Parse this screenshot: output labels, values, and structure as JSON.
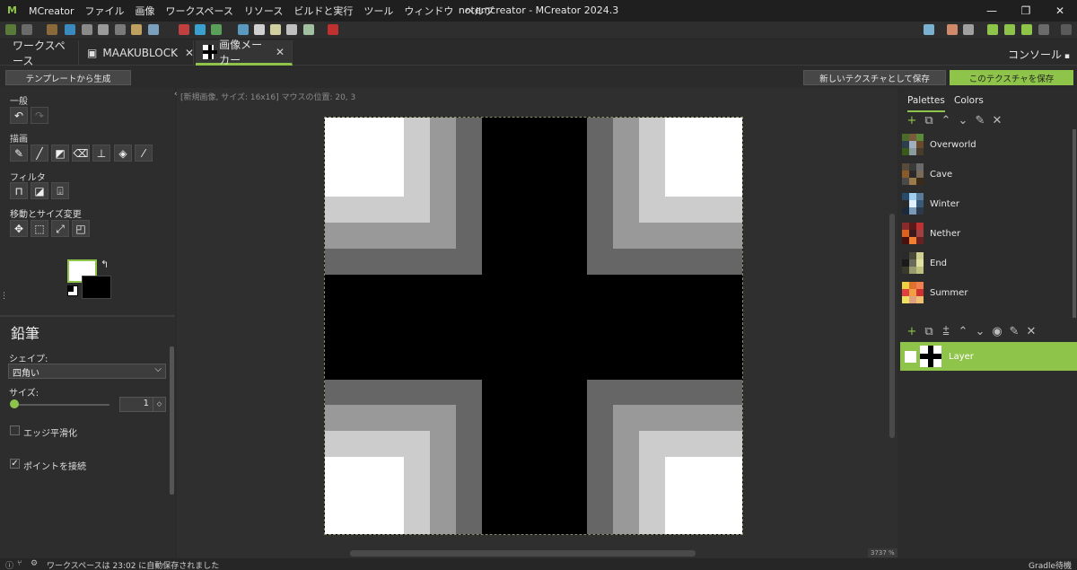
{
  "titlebar": {
    "menus": [
      "MCreator",
      "ファイル",
      "画像",
      "ワークスペース",
      "リソース",
      "ビルドと実行",
      "ツール",
      "ウィンドウ",
      "ヘルプ"
    ],
    "window_title": "notemcreator - MCreator 2024.3"
  },
  "tabs": {
    "workspace": "ワークスペース",
    "mod_element": "MAAKUBLOCK",
    "image_maker": "画像メーカー",
    "console": "コンソール"
  },
  "actions": {
    "template": "テンプレートから生成",
    "save_new": "新しいテクスチャとして保存",
    "save_this": "このテクスチャを保存"
  },
  "left": {
    "general": "一般",
    "draw": "描画",
    "filter": "フィルタ",
    "transform": "移動とサイズ変更",
    "tool_title": "鉛筆",
    "shape_label": "シェイプ:",
    "shape_value": "四角い",
    "size_label": "サイズ:",
    "size_value": "1",
    "antialias_label": "エッジ平滑化",
    "antialias_checked": false,
    "connect_label": "ポイントを接続",
    "connect_checked": true
  },
  "canvas": {
    "info": "[新規画像, サイズ: 16x16] マウスの位置: 20, 3",
    "zoom": "3737 %"
  },
  "right": {
    "tab_palettes": "Palettes",
    "tab_colors": "Colors",
    "palettes": [
      {
        "name": "Overworld",
        "colors": [
          "#4a6b2a",
          "#7a5a3a",
          "#5a8a3a",
          "#2e3e4e",
          "#a0b0c0",
          "#6a4a2a",
          "#3a5a1a",
          "#8a9aa0",
          "#4a3a2a"
        ]
      },
      {
        "name": "Cave",
        "colors": [
          "#5a4a3a",
          "#3a3a3a",
          "#6a6a6a",
          "#8a5a2a",
          "#2a2a2a",
          "#7a6a5a",
          "#4a4a4a",
          "#9a7a4a",
          "#3a2a1a"
        ]
      },
      {
        "name": "Winter",
        "colors": [
          "#2a4a6a",
          "#a0d0f0",
          "#5a7a9a",
          "#2a2a2a",
          "#e0f0ff",
          "#3a5a7a",
          "#1a2a3a",
          "#7a9aba",
          "#2a3a4a"
        ]
      },
      {
        "name": "Nether",
        "colors": [
          "#8a2a2a",
          "#5a1a1a",
          "#c03030",
          "#e06020",
          "#3a1a1a",
          "#a04040",
          "#4a1010",
          "#f08030",
          "#6a2020"
        ]
      },
      {
        "name": "End",
        "colors": [
          "#2a2a2a",
          "#4a4a3a",
          "#d0d090",
          "#1a1a1a",
          "#6a6a5a",
          "#e0e0a0",
          "#3a3a2a",
          "#9a9a70",
          "#c0c080"
        ]
      },
      {
        "name": "Summer",
        "colors": [
          "#f0d040",
          "#e07030",
          "#f08050",
          "#e04040",
          "#f0a040",
          "#d03030",
          "#f0e060",
          "#e0a080",
          "#f0c070"
        ]
      }
    ],
    "layer_name": "Layer"
  },
  "status": {
    "autosave": "ワークスペースは 23:02 に自動保存されました",
    "gradle": "Gradle待機"
  },
  "colors": {
    "accent": "#8fc44a"
  }
}
